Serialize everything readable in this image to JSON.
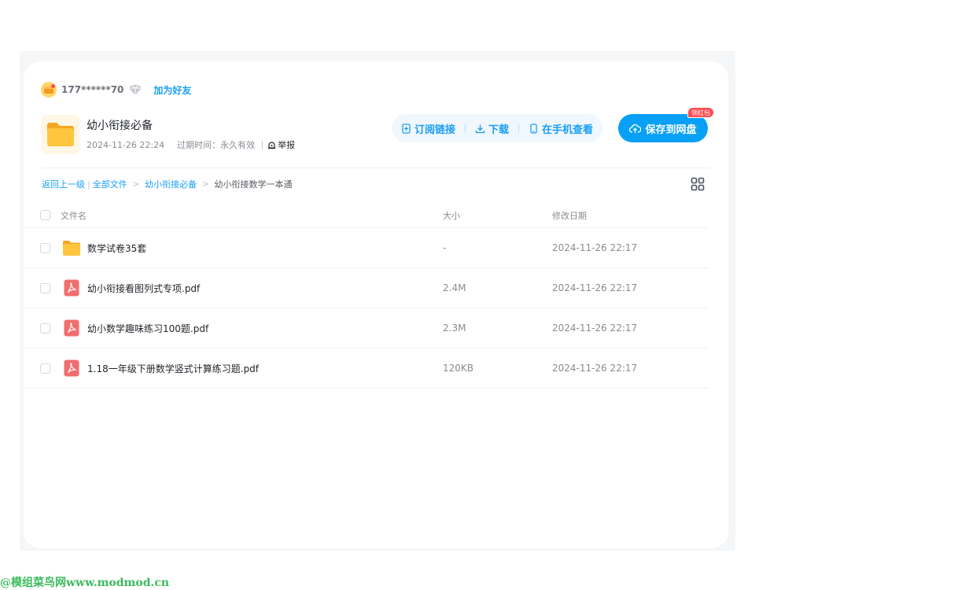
{
  "user": {
    "name": "177******70",
    "add_friend_label": "加为好友"
  },
  "share": {
    "title": "幼小衔接必备",
    "created": "2024-11-26 22:24",
    "expire": "过期时间：永久有效",
    "report_label": "举报"
  },
  "actions": {
    "subscribe_label": "订阅链接",
    "download_label": "下载",
    "mobile_label": "在手机查看",
    "save_label": "保存到网盘",
    "save_badge": "领红包"
  },
  "breadcrumb": {
    "back_label": "返回上一级",
    "all_files_label": "全部文件",
    "parent_label": "幼小衔接必备",
    "current_label": "幼小衔接数学一本通"
  },
  "table": {
    "headers": {
      "name": "文件名",
      "size": "大小",
      "date": "修改日期"
    },
    "rows": [
      {
        "type": "folder",
        "name": "数学试卷35套",
        "size": "-",
        "date": "2024-11-26 22:17"
      },
      {
        "type": "pdf",
        "name": "幼小衔接看图列式专项.pdf",
        "size": "2.4M",
        "date": "2024-11-26 22:17"
      },
      {
        "type": "pdf",
        "name": "幼小数学趣味练习100题.pdf",
        "size": "2.3M",
        "date": "2024-11-26 22:17"
      },
      {
        "type": "pdf",
        "name": "1.18一年级下册数学竖式计算练习题.pdf",
        "size": "120KB",
        "date": "2024-11-26 22:17"
      }
    ]
  },
  "watermark": "@模组菜鸟网www.modmod.cn",
  "colors": {
    "accent": "#1a9ff5",
    "save_button": "#08a0f7",
    "badge": "#ff4d4f",
    "folder": "#ffc53d",
    "pdf": "#f26d6d",
    "watermark": "#3dbb5d"
  },
  "icons": {
    "avatar": "avatar-icon",
    "vip": "diamond-icon",
    "folder": "folder-icon",
    "pdf": "pdf-icon",
    "subscribe": "subscribe-icon",
    "download": "download-icon",
    "mobile": "phone-icon",
    "save": "cloud-upload-icon",
    "report": "alarm-icon",
    "grid": "grid-view-icon"
  }
}
